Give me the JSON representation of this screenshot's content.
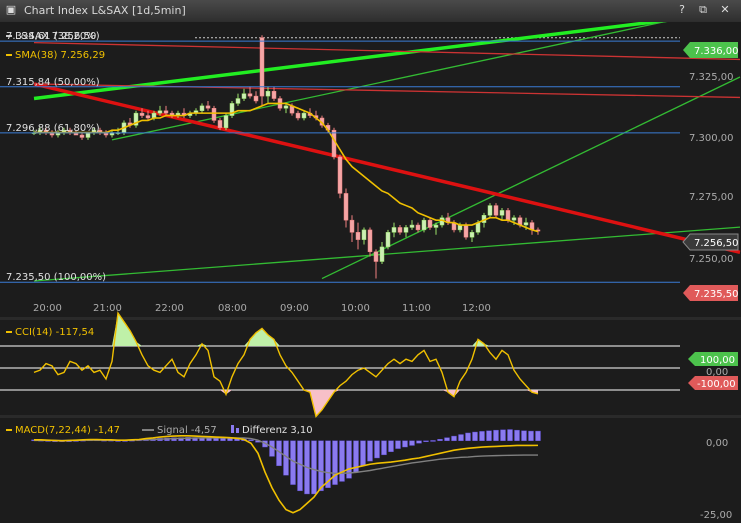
{
  "window": {
    "title": "Chart Index L&SAX [1d,5min]"
  },
  "colors": {
    "bg": "#1c1c1c",
    "grid": "#ffffff",
    "up": "#9be36a",
    "down": "#f08080",
    "sma": "#f0c000",
    "ch_thick": "#22ee22",
    "ch_thin": "#33bb33",
    "red_thick": "#dd1111",
    "red_thin": "#cc3333",
    "blue": "#3a7bd5",
    "macd_hist": "#8a7af0",
    "signal": "#808080"
  },
  "main": {
    "legend_index": "L&SAX 7.256,50",
    "legend_sma": "SMA(38) 7.256,29",
    "fib_labels": [
      {
        "text": "7.334,61 (38,20%)",
        "price": 7334.61
      },
      {
        "text": "7.315,84 (50,00%)",
        "price": 7315.84
      },
      {
        "text": "7.296,88 (61,80%)",
        "price": 7296.88
      },
      {
        "text": "7.235,50 (100,00%)",
        "price": 7235.5
      }
    ],
    "y_ticks": [
      "7.325,00",
      "7.300,00",
      "7.275,00",
      "7.250,00"
    ],
    "tag_high": "7.336,00",
    "tag_last": "7.256,50",
    "tag_low": "7.235,50",
    "x_ticks": [
      "20:00",
      "21:00",
      "22:00",
      "08:00",
      "09:00",
      "10:00",
      "11:00",
      "12:00"
    ]
  },
  "cci": {
    "label": "CCI(14) -117,54",
    "tag_upper": "100,00",
    "tick_zero": "0,00",
    "tag_lower": "-100,00"
  },
  "macd": {
    "label_macd": "MACD(7,22,44) -1,47",
    "label_signal": "Signal -4,57",
    "label_diff": "Differenz 3,10",
    "y_ticks": [
      "0,00",
      "-25,00"
    ]
  },
  "chart_data": [
    {
      "type": "candlestick",
      "title": "Chart Index L&SAX [1d,5min]",
      "ylim": [
        7229,
        7340
      ],
      "x_ticks": [
        "20:00",
        "21:00",
        "22:00",
        "08:00",
        "09:00",
        "10:00",
        "11:00",
        "12:00"
      ],
      "candles_ohlc": [
        [
          7297,
          7298,
          7296,
          7297
        ],
        [
          7297,
          7299,
          7296,
          7298
        ],
        [
          7298,
          7299,
          7296,
          7297
        ],
        [
          7297,
          7298,
          7295,
          7296
        ],
        [
          7296,
          7298,
          7295,
          7297
        ],
        [
          7297,
          7299,
          7296,
          7298
        ],
        [
          7298,
          7299,
          7296,
          7297
        ],
        [
          7297,
          7298,
          7296,
          7296
        ],
        [
          7296,
          7297,
          7294,
          7295
        ],
        [
          7295,
          7297,
          7294,
          7297
        ],
        [
          7297,
          7299,
          7296,
          7298
        ],
        [
          7298,
          7299,
          7296,
          7297
        ],
        [
          7297,
          7298,
          7295,
          7296
        ],
        [
          7296,
          7298,
          7295,
          7297
        ],
        [
          7297,
          7299,
          7296,
          7297
        ],
        [
          7297,
          7302,
          7296,
          7301
        ],
        [
          7301,
          7303,
          7299,
          7300
        ],
        [
          7300,
          7306,
          7299,
          7305
        ],
        [
          7305,
          7307,
          7303,
          7304
        ],
        [
          7304,
          7306,
          7302,
          7303
        ],
        [
          7303,
          7306,
          7302,
          7305
        ],
        [
          7305,
          7308,
          7304,
          7306
        ],
        [
          7306,
          7308,
          7304,
          7305
        ],
        [
          7305,
          7306,
          7303,
          7304
        ],
        [
          7304,
          7306,
          7303,
          7305
        ],
        [
          7305,
          7307,
          7303,
          7304
        ],
        [
          7304,
          7306,
          7303,
          7305
        ],
        [
          7305,
          7307,
          7304,
          7306
        ],
        [
          7306,
          7309,
          7305,
          7308
        ],
        [
          7308,
          7310,
          7306,
          7307
        ],
        [
          7307,
          7308,
          7301,
          7302
        ],
        [
          7302,
          7303,
          7298,
          7299
        ],
        [
          7299,
          7305,
          7298,
          7304
        ],
        [
          7304,
          7310,
          7303,
          7309
        ],
        [
          7309,
          7313,
          7308,
          7311
        ],
        [
          7311,
          7315,
          7310,
          7313
        ],
        [
          7313,
          7316,
          7311,
          7312
        ],
        [
          7312,
          7314,
          7309,
          7310
        ],
        [
          7336,
          7337,
          7308,
          7312
        ],
        [
          7312,
          7316,
          7309,
          7314
        ],
        [
          7314,
          7316,
          7310,
          7311
        ],
        [
          7311,
          7312,
          7306,
          7307
        ],
        [
          7307,
          7309,
          7305,
          7308
        ],
        [
          7308,
          7309,
          7304,
          7305
        ],
        [
          7305,
          7306,
          7302,
          7303
        ],
        [
          7303,
          7306,
          7302,
          7305
        ],
        [
          7305,
          7307,
          7303,
          7304
        ],
        [
          7304,
          7306,
          7302,
          7303
        ],
        [
          7303,
          7304,
          7299,
          7300
        ],
        [
          7300,
          7301,
          7297,
          7298
        ],
        [
          7298,
          7299,
          7286,
          7287
        ],
        [
          7287,
          7288,
          7270,
          7272
        ],
        [
          7272,
          7274,
          7258,
          7261
        ],
        [
          7261,
          7263,
          7252,
          7256
        ],
        [
          7256,
          7260,
          7249,
          7253
        ],
        [
          7253,
          7258,
          7251,
          7257
        ],
        [
          7257,
          7258,
          7246,
          7248
        ],
        [
          7248,
          7249,
          7237,
          7244
        ],
        [
          7244,
          7252,
          7243,
          7250
        ],
        [
          7250,
          7257,
          7249,
          7256
        ],
        [
          7256,
          7260,
          7254,
          7258
        ],
        [
          7258,
          7259,
          7255,
          7256
        ],
        [
          7256,
          7259,
          7254,
          7258
        ],
        [
          7258,
          7261,
          7257,
          7259
        ],
        [
          7259,
          7260,
          7256,
          7257
        ],
        [
          7257,
          7262,
          7256,
          7261
        ],
        [
          7261,
          7262,
          7257,
          7258
        ],
        [
          7258,
          7260,
          7255,
          7259
        ],
        [
          7259,
          7263,
          7258,
          7262
        ],
        [
          7262,
          7264,
          7259,
          7260
        ],
        [
          7260,
          7261,
          7256,
          7257
        ],
        [
          7257,
          7260,
          7256,
          7259
        ],
        [
          7259,
          7260,
          7253,
          7254
        ],
        [
          7254,
          7257,
          7252,
          7256
        ],
        [
          7256,
          7261,
          7255,
          7260
        ],
        [
          7260,
          7264,
          7258,
          7263
        ],
        [
          7263,
          7268,
          7262,
          7267
        ],
        [
          7267,
          7268,
          7262,
          7263
        ],
        [
          7263,
          7266,
          7261,
          7265
        ],
        [
          7265,
          7266,
          7260,
          7261
        ],
        [
          7261,
          7263,
          7259,
          7262
        ],
        [
          7262,
          7263,
          7258,
          7259
        ],
        [
          7259,
          7262,
          7257,
          7260
        ],
        [
          7260,
          7261,
          7255,
          7257
        ],
        [
          7257,
          7258,
          7255,
          7256.5
        ]
      ],
      "sma38": [
        7297,
        7297,
        7297,
        7297,
        7297,
        7297,
        7297,
        7297,
        7297,
        7297,
        7297,
        7297,
        7297,
        7298,
        7298,
        7299,
        7300,
        7301,
        7302,
        7302,
        7303,
        7303,
        7304,
        7304,
        7304,
        7304,
        7305,
        7305,
        7305,
        7305,
        7305,
        7305,
        7305,
        7305,
        7306,
        7306,
        7306,
        7307,
        7308,
        7309,
        7309,
        7309,
        7309,
        7308,
        7307,
        7306,
        7305,
        7303,
        7301,
        7298,
        7294,
        7290,
        7286,
        7283,
        7281,
        7279,
        7277,
        7275,
        7273,
        7272,
        7270,
        7268,
        7267,
        7266,
        7264,
        7263,
        7262,
        7261,
        7261,
        7260,
        7260,
        7259,
        7259,
        7259,
        7260,
        7261,
        7262,
        7262,
        7261,
        7261,
        7260,
        7259,
        7258,
        7257,
        7256.29
      ],
      "lines": [
        {
          "name": "green-channel-thick",
          "from": [
            0,
            7311
          ],
          "to": [
            82,
            7336
          ]
        },
        {
          "name": "green-channel-thin-upper",
          "from": [
            13,
            7294
          ],
          "to": [
            85,
            7332
          ]
        },
        {
          "name": "green-channel-thin-lower",
          "from": [
            48,
            7237
          ],
          "to": [
            85,
            7281
          ]
        },
        {
          "name": "green-base-line",
          "from": [
            0,
            7236
          ],
          "to": [
            85,
            7252
          ]
        },
        {
          "name": "red-trend-thick",
          "from": [
            0,
            7317
          ],
          "to": [
            85,
            7267
          ]
        },
        {
          "name": "red-trend-upper",
          "from": [
            0,
            7334
          ],
          "to": [
            85,
            7329
          ]
        },
        {
          "name": "red-trend-middle",
          "from": [
            0,
            7317
          ],
          "to": [
            85,
            7313
          ]
        }
      ]
    },
    {
      "type": "line",
      "title": "CCI(14) -117,54",
      "ylim": [
        -200,
        200
      ],
      "reference_lines": [
        100,
        0,
        -100
      ],
      "values": [
        -20,
        -10,
        20,
        10,
        -30,
        -20,
        30,
        20,
        -10,
        10,
        -20,
        -10,
        -50,
        30,
        250,
        210,
        170,
        120,
        60,
        10,
        -10,
        -20,
        10,
        40,
        -20,
        -40,
        20,
        60,
        110,
        80,
        -40,
        -60,
        -120,
        -40,
        20,
        60,
        130,
        160,
        180,
        150,
        130,
        60,
        10,
        -20,
        -60,
        -100,
        -110,
        -220,
        -190,
        -150,
        -110,
        -80,
        -60,
        -30,
        -10,
        0,
        -20,
        -40,
        -10,
        20,
        40,
        20,
        40,
        30,
        60,
        80,
        30,
        40,
        -20,
        -110,
        -130,
        -60,
        -20,
        40,
        130,
        110,
        70,
        40,
        80,
        60,
        -10,
        -50,
        -80,
        -110,
        -117.54
      ]
    },
    {
      "type": "bar",
      "title": "MACD(7,22,44) -1,47",
      "ylim": [
        -25,
        6
      ],
      "series": [
        {
          "name": "Differenz",
          "values": [
            0.3,
            0.2,
            0.1,
            0,
            -0.1,
            0,
            0.1,
            0.2,
            0.3,
            0.3,
            0.2,
            0.2,
            0.1,
            0.1,
            0.2,
            0.3,
            0.5,
            0.6,
            0.8,
            0.9,
            1,
            1,
            1.1,
            1,
            1,
            0.9,
            0.9,
            0.8,
            0.8,
            0.7,
            0.6,
            0.3,
            -0.5,
            -2,
            -5,
            -8,
            -11,
            -14,
            -16,
            -17,
            -17,
            -16,
            -15,
            -14,
            -13,
            -12,
            -10,
            -8,
            -6.5,
            -5.5,
            -4.5,
            -3.5,
            -2.5,
            -2,
            -1.5,
            -0.8,
            -0.3,
            0.1,
            0.5,
            1,
            1.5,
            2,
            2.5,
            2.8,
            3,
            3.2,
            3.4,
            3.5,
            3.6,
            3.4,
            3.2,
            3.1,
            3.1
          ]
        },
        {
          "name": "MACD",
          "values": [
            0.3,
            0.3,
            0.2,
            0.1,
            0,
            0.1,
            0.2,
            0.3,
            0.4,
            0.4,
            0.3,
            0.3,
            0.2,
            0.2,
            0.3,
            0.4,
            0.7,
            0.9,
            1.2,
            1.4,
            1.5,
            1.6,
            1.6,
            1.5,
            1.4,
            1.3,
            1.2,
            1.1,
            1,
            0.8,
            0.4,
            -0.8,
            -4,
            -10,
            -15,
            -19,
            -22,
            -23,
            -22,
            -20,
            -18,
            -15,
            -13,
            -11,
            -10,
            -9,
            -8.5,
            -8,
            -7.5,
            -7.2,
            -7,
            -6.8,
            -6.5,
            -6.2,
            -5.8,
            -5.5,
            -5,
            -4.5,
            -4,
            -3.5,
            -3,
            -2.7,
            -2.4,
            -2.2,
            -2,
            -1.9,
            -1.8,
            -1.7,
            -1.6,
            -1.5,
            -1.5,
            -1.5,
            -1.47
          ]
        },
        {
          "name": "Signal",
          "values": [
            0.1,
            0.1,
            0.1,
            0.1,
            0.1,
            0.1,
            0.1,
            0.2,
            0.2,
            0.2,
            0.2,
            0.2,
            0.2,
            0.2,
            0.2,
            0.3,
            0.3,
            0.4,
            0.5,
            0.6,
            0.7,
            0.8,
            0.8,
            0.9,
            0.9,
            0.9,
            0.9,
            0.9,
            0.9,
            0.9,
            0.9,
            0.7,
            0.2,
            -0.8,
            -2,
            -3.5,
            -5,
            -6.5,
            -7.5,
            -8.5,
            -9.2,
            -9.8,
            -10.2,
            -10.4,
            -10.4,
            -10.3,
            -10.1,
            -9.8,
            -9.5,
            -9.1,
            -8.7,
            -8.3,
            -7.9,
            -7.5,
            -7.1,
            -6.8,
            -6.5,
            -6.2,
            -5.9,
            -5.7,
            -5.5,
            -5.3,
            -5.2,
            -5,
            -4.9,
            -4.8,
            -4.75,
            -4.7,
            -4.65,
            -4.6,
            -4.58,
            -4.57,
            -4.57
          ]
        }
      ]
    }
  ]
}
